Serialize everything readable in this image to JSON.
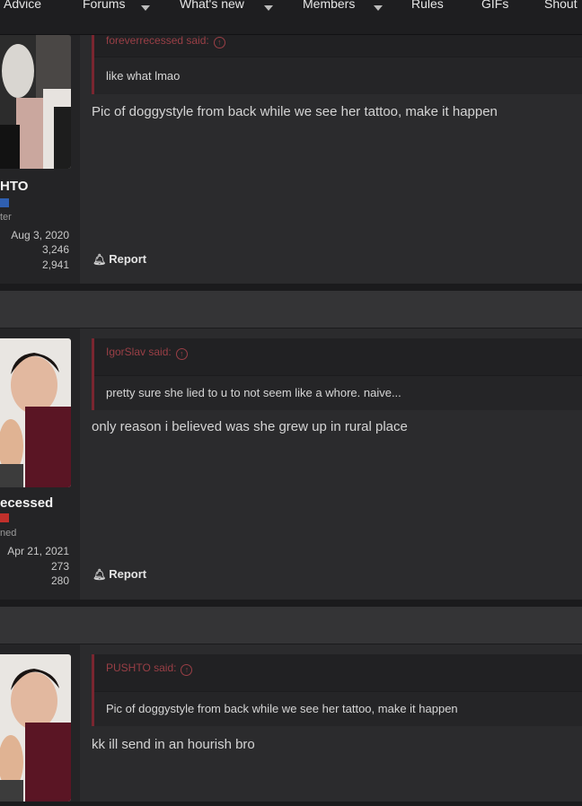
{
  "nav": {
    "items": [
      {
        "label": "Advice"
      },
      {
        "label": "Forums"
      },
      {
        "label": "What's new"
      },
      {
        "label": "Members"
      },
      {
        "label": "Rules"
      },
      {
        "label": "GIFs"
      },
      {
        "label": "Shout"
      }
    ]
  },
  "posts": [
    {
      "username": "HTO",
      "role": "ter",
      "stats": [
        "Aug 3, 2020",
        "3,246",
        "2,941"
      ],
      "quote": {
        "author": "foreverrecessed said:",
        "text": "like what lmao"
      },
      "message": "Pic of doggystyle from back while we see her tattoo, make it happen",
      "report_label": "Report",
      "banner_color": "#2f5fb0"
    },
    {
      "username": "ecessed",
      "role": "ned",
      "stats": [
        "Apr 21, 2021",
        "273",
        "280"
      ],
      "quote": {
        "author": "IgorSlav said:",
        "text": "pretty sure she lied to u to not seem like a whore. naive..."
      },
      "message": "only reason i believed was she grew up in rural place",
      "report_label": "Report",
      "banner_color": "#c0302b"
    },
    {
      "quote": {
        "author": "PUSHTO said:",
        "text": "Pic of doggystyle from back while we see her tattoo, make it happen"
      },
      "message": "kk ill send in an hourish bro"
    }
  ],
  "icons": {
    "report": "bell-icon",
    "quote_up": "arrow-up-circle-icon"
  }
}
